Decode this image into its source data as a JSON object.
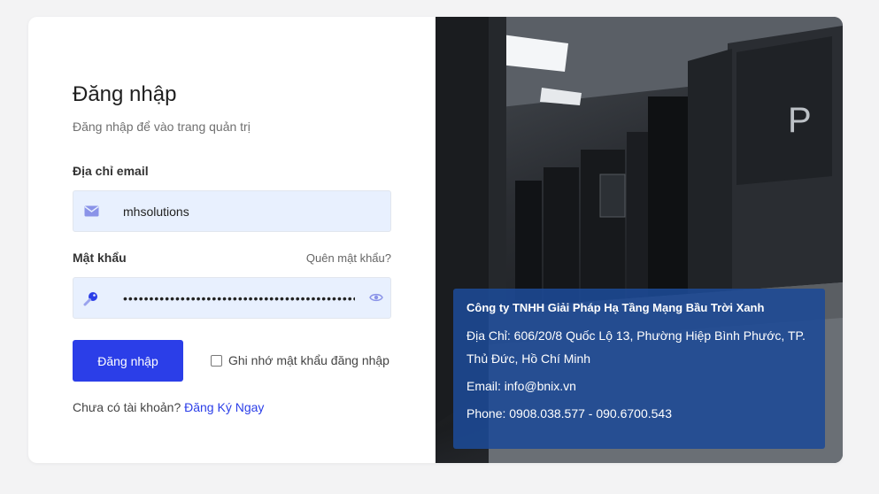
{
  "login": {
    "title": "Đăng nhập",
    "subtitle": "Đăng nhập để vào trang quản trị",
    "email_label": "Địa chỉ email",
    "email_value": "mhsolutions",
    "password_label": "Mật khẩu",
    "forgot_link": "Quên mật khẩu?",
    "password_value": "••••••••••••••••••••••••••••••••••••••••••••••••••",
    "submit_label": "Đăng nhập",
    "remember_label": "Ghi nhớ mật khẩu đăng nhập",
    "remember_checked": false,
    "signup_prompt": "Chưa có tài khoản?",
    "signup_link": "Đăng Ký Ngay"
  },
  "company": {
    "name": "Công ty TNHH Giải Pháp Hạ Tầng Mạng Bầu Trời Xanh",
    "address": "Địa Chỉ: 606/20/8 Quốc Lộ 13, Phường Hiệp Bình Phước, TP. Thủ Đức, Hồ Chí Minh",
    "email": "Email: info@bnix.vn",
    "phone": "Phone: 0908.038.577 - 090.6700.543"
  },
  "icons": {
    "email": "envelope-icon",
    "password": "key-icon",
    "toggle_password": "eye-icon"
  },
  "colors": {
    "primary": "#2b3ee8",
    "input_bg": "#e8f0fe",
    "info_panel": "#1c4a96"
  }
}
